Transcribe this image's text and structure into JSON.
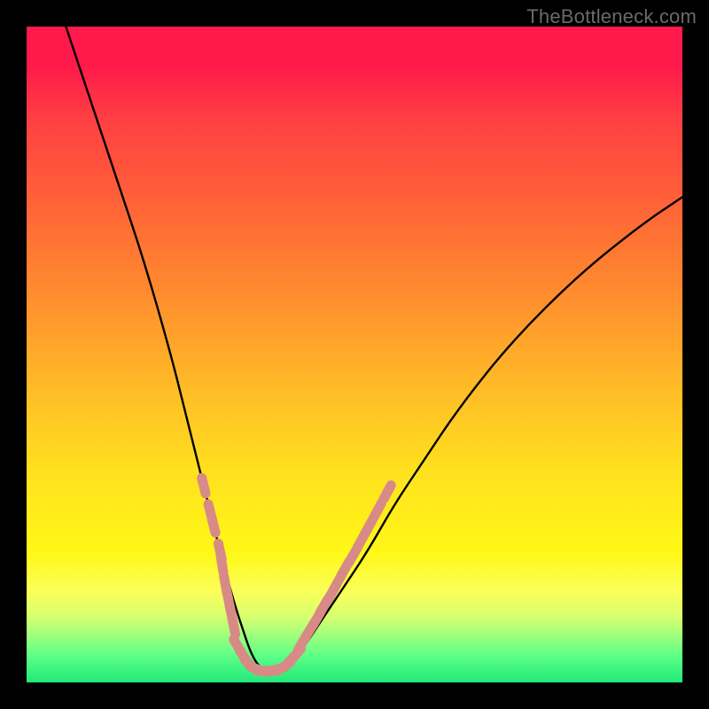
{
  "watermark": "TheBottleneck.com",
  "colors": {
    "background": "#000000",
    "curve": "#000000",
    "markers": "#d88a87",
    "gradient_top": "#ff1a4b",
    "gradient_bottom": "#22e87a"
  },
  "chart_data": {
    "type": "line",
    "title": "",
    "xlabel": "",
    "ylabel": "",
    "xlim": [
      0,
      100
    ],
    "ylim": [
      0,
      100
    ],
    "grid": false,
    "legend": false,
    "series": [
      {
        "name": "bottleneck-curve",
        "x": [
          6,
          10,
          14,
          18,
          22,
          24,
          26,
          28,
          30,
          32,
          33,
          34,
          35,
          36,
          37,
          38,
          40,
          42,
          44,
          48,
          52,
          56,
          60,
          66,
          74,
          84,
          94,
          100
        ],
        "values": [
          100,
          88,
          76,
          64,
          50,
          42,
          34,
          26,
          18,
          11,
          8,
          5,
          3,
          2,
          2,
          2,
          3,
          5,
          8,
          14,
          20,
          27,
          33,
          42,
          52,
          62,
          70,
          74
        ]
      }
    ],
    "markers": [
      {
        "name": "marker-cluster-left",
        "x": [
          27,
          28,
          28.5,
          29.5,
          29.8,
          30.3,
          30.8,
          31.2,
          31.6
        ],
        "values": [
          30,
          26,
          24,
          20,
          18,
          15,
          12.5,
          10.5,
          8.5
        ]
      },
      {
        "name": "marker-cluster-bottom",
        "x": [
          32.2,
          33.2,
          34.2,
          35.2,
          36.2,
          37.2,
          38.2,
          39.2,
          40.1,
          41.0
        ],
        "values": [
          5.5,
          3.8,
          2.6,
          2.0,
          1.8,
          1.8,
          2.0,
          2.4,
          3.2,
          4.2
        ]
      },
      {
        "name": "marker-cluster-right",
        "x": [
          42.0,
          43.2,
          44.3,
          45.3,
          46.4,
          47.5,
          48.6,
          49.8,
          51.0,
          52.2,
          53.5,
          55.0
        ],
        "values": [
          6.0,
          8.0,
          9.8,
          11.6,
          13.4,
          15.4,
          17.4,
          19.4,
          21.6,
          23.8,
          26.2,
          29.0
        ]
      }
    ]
  }
}
